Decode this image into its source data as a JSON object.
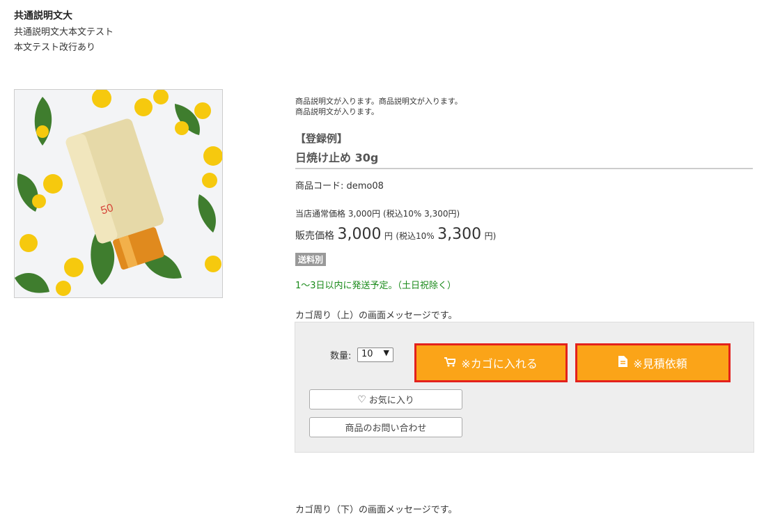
{
  "common": {
    "title": "共通説明文大",
    "body_line1": "共通説明文大本文テスト",
    "body_line2": "本文テスト改行あり"
  },
  "product": {
    "desc_line1": "商品説明文が入ります。商品説明文が入ります。",
    "desc_line2": "商品説明文が入ります。",
    "example_label": "【登録例】",
    "name": "日焼け止め 30g",
    "code_label": "商品コード: ",
    "code_value": "demo08",
    "regular_price_text": "当店通常価格 3,000円 (税込10% 3,300円)",
    "sale_label": "販売価格",
    "sale_price": "3,000",
    "sale_unit": "円",
    "tax_label": "(税込10%",
    "tax_price": "3,300",
    "tax_unit": "円)",
    "shipping_badge": "送料別",
    "delivery_text": "1～3日以内に発送予定。（土日祝除く）",
    "image_icon": "sunscreen-tube-with-yellow-flowers"
  },
  "cart": {
    "message_top": "カゴ周り（上）の画面メッセージです。",
    "qty_label": "数量:",
    "qty_value": "10",
    "add_to_cart_label": "※カゴに入れる",
    "quote_label": "※見積依頼",
    "favorite_label": "お気に入り",
    "inquiry_label": "商品のお問い合わせ",
    "message_bottom": "カゴ周り（下）の画面メッセージです。"
  },
  "colors": {
    "button_orange": "#fba418",
    "button_border_red": "#e3211c",
    "delivery_green": "#1a8a1a",
    "badge_gray": "#999999",
    "cart_box_bg": "#eeeeee"
  }
}
